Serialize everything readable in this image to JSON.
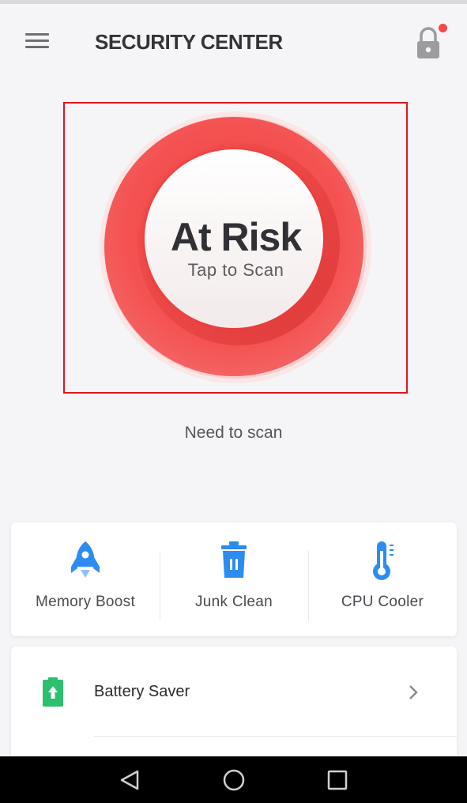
{
  "header": {
    "title": "SECURITY CENTER",
    "menu_icon": "hamburger-menu-icon",
    "lock_icon": "lock-icon",
    "notification_color": "#f44848"
  },
  "scan": {
    "status": "At Risk",
    "action": "Tap to Scan",
    "message": "Need to scan",
    "accent_color": "#f04545"
  },
  "tools": [
    {
      "label": "Memory Boost",
      "icon": "rocket-icon"
    },
    {
      "label": "Junk Clean",
      "icon": "trash-icon"
    },
    {
      "label": "CPU Cooler",
      "icon": "thermometer-icon"
    }
  ],
  "list": [
    {
      "label": "Battery Saver",
      "icon": "battery-icon",
      "icon_color": "#2bbf6e"
    }
  ],
  "colors": {
    "tool_icon_blue": "#2d8cf0",
    "background": "#f5f5f7"
  },
  "system_nav": [
    "back-icon",
    "home-icon",
    "recents-icon"
  ]
}
